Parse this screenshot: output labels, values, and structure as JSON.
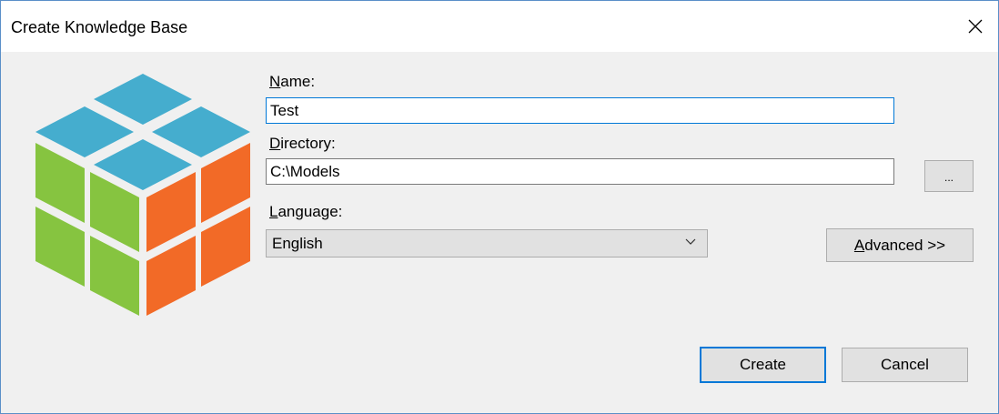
{
  "window": {
    "title": "Create Knowledge Base",
    "close_icon": "close-icon"
  },
  "logo": {
    "icon": "cube-logo-icon",
    "colors": {
      "top": "#45adce",
      "left": "#86c440",
      "right": "#f26a27"
    }
  },
  "form": {
    "name_label_key": "N",
    "name_label_rest": "ame:",
    "name_value": "Test",
    "directory_label_key": "D",
    "directory_label_rest": "irectory:",
    "directory_value": "C:\\Models",
    "browse_label": "...",
    "language_label_key": "L",
    "language_label_rest": "anguage:",
    "language_value": "English",
    "advanced_label_key": "A",
    "advanced_label_rest": "dvanced >>"
  },
  "actions": {
    "create_label": "Create",
    "cancel_label": "Cancel"
  },
  "colors": {
    "accent": "#0078d7",
    "dialog_bg": "#f0f0f0",
    "button_bg": "#e1e1e1"
  }
}
